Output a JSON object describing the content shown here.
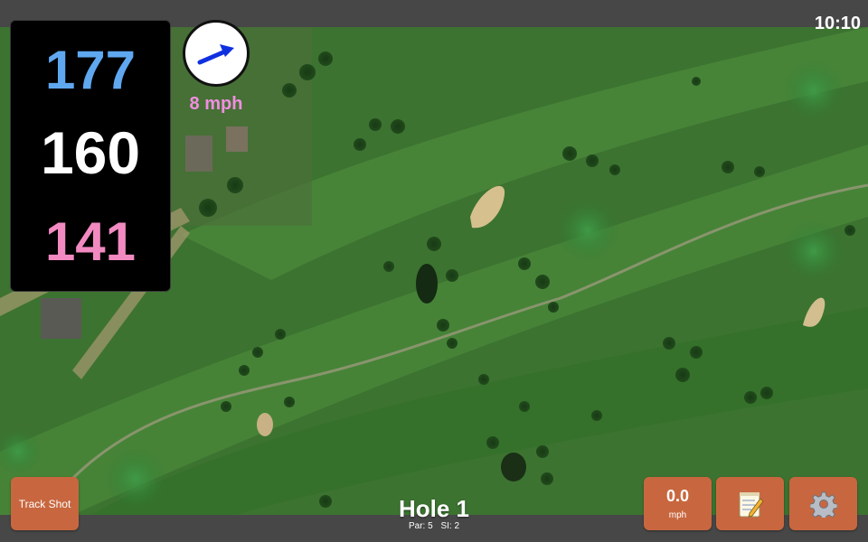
{
  "status": {
    "time": "10:10"
  },
  "distances": {
    "back": "177",
    "middle": "160",
    "front": "141"
  },
  "wind": {
    "speed": "8 mph",
    "arrow_icon": "wind-direction-arrow-icon"
  },
  "buttons": {
    "track_shot": "Track Shot",
    "speed_value": "0.0",
    "speed_unit": "mph",
    "notes_icon": "notepad-icon",
    "settings_icon": "gear-icon"
  },
  "hole": {
    "title": "Hole 1",
    "par": "Par: 5",
    "si": "SI: 2"
  },
  "colors": {
    "back": "#5fa8f0",
    "middle": "#ffffff",
    "front": "#f28ac1",
    "wind_text": "#f08ee0",
    "button": "#c8673f"
  }
}
